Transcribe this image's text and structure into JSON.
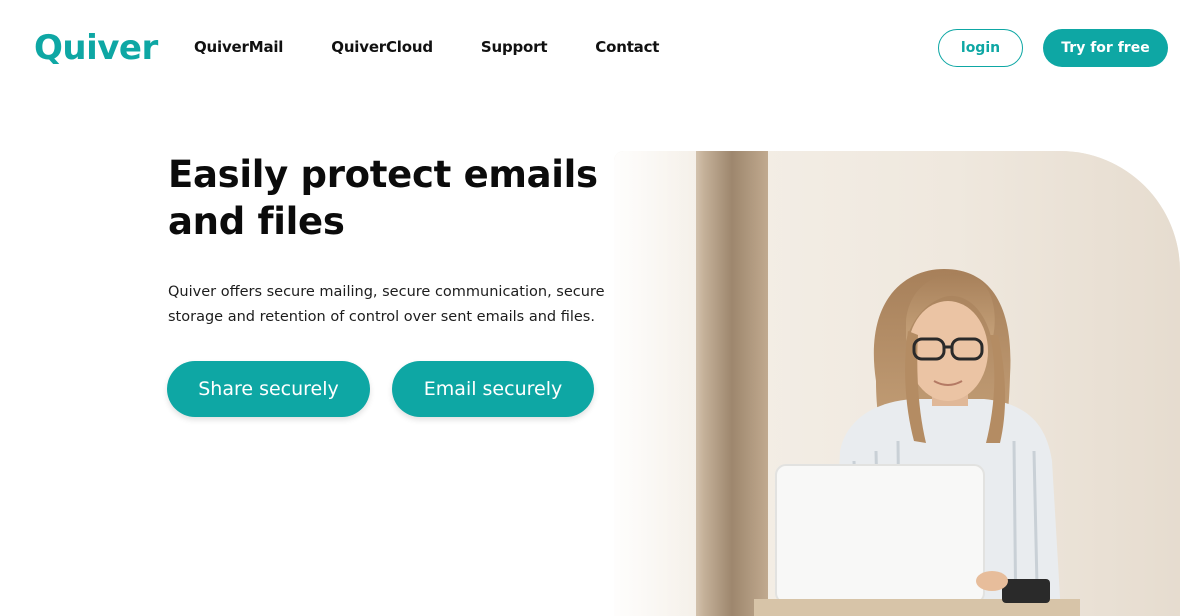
{
  "brand": {
    "name": "Quiver",
    "color": "#0ea7a4"
  },
  "nav": {
    "items": [
      {
        "label": "QuiverMail"
      },
      {
        "label": "QuiverCloud"
      },
      {
        "label": "Support"
      },
      {
        "label": "Contact"
      }
    ],
    "login_label": "login",
    "try_label": "Try for free"
  },
  "hero": {
    "title_line1": "Easily protect emails",
    "title_line2": "and files",
    "description_line1": "Quiver offers secure mailing, secure communication, secure",
    "description_line2": "storage and retention of control over sent emails and files.",
    "share_label": "Share securely",
    "email_label": "Email securely"
  },
  "image": {
    "subject": "woman-working-on-laptop-photo"
  }
}
